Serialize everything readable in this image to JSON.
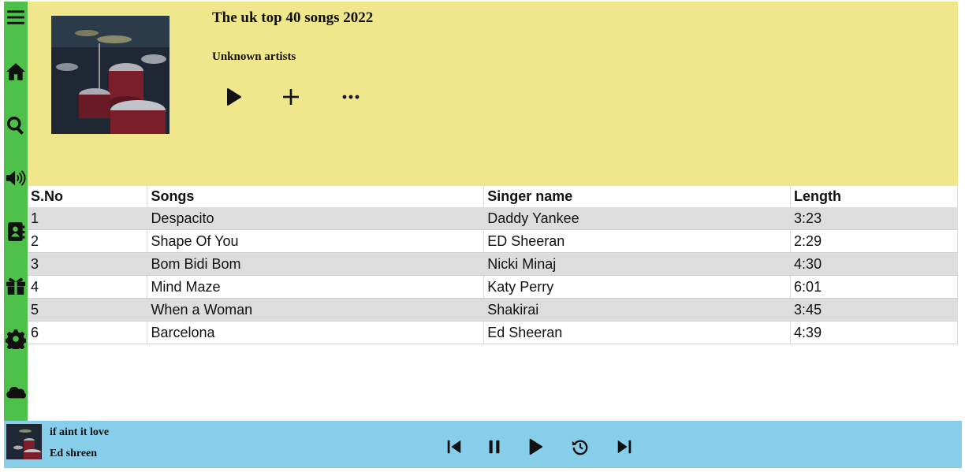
{
  "sidebar": {
    "icons": [
      "menu-icon",
      "home-icon",
      "search-icon",
      "volume-icon",
      "address-book-icon",
      "gift-icon",
      "gear-icon",
      "cloud-icon"
    ]
  },
  "album": {
    "title": "The uk top 40 songs 2022",
    "artist": "Unknown artists",
    "actions": [
      "play-icon",
      "plus-icon",
      "more-icon"
    ]
  },
  "tracks": {
    "columns": [
      "S.No",
      "Songs",
      "Singer name",
      "Length"
    ],
    "rows": [
      [
        "1",
        "Despacito",
        "Daddy Yankee",
        "3:23"
      ],
      [
        "2",
        "Shape Of You",
        "ED Sheeran",
        "2:29"
      ],
      [
        "3",
        "Bom Bidi Bom",
        "Nicki Minaj",
        "4:30"
      ],
      [
        "4",
        "Mind Maze",
        "Katy Perry",
        "6:01"
      ],
      [
        "5",
        "When a Woman",
        "Shakirai",
        "3:45"
      ],
      [
        "6",
        "Barcelona",
        "Ed Sheeran",
        "4:39"
      ]
    ]
  },
  "player": {
    "title": "if aint it love",
    "artist": "Ed shreen",
    "controls": [
      "skip-back-icon",
      "pause-icon",
      "play-icon",
      "history-icon",
      "skip-forward-icon"
    ]
  },
  "colors": {
    "sidebar": "#4ec14a",
    "header": "#f0e68c",
    "player": "#87ceeb",
    "row_alt": "#dddddd"
  }
}
